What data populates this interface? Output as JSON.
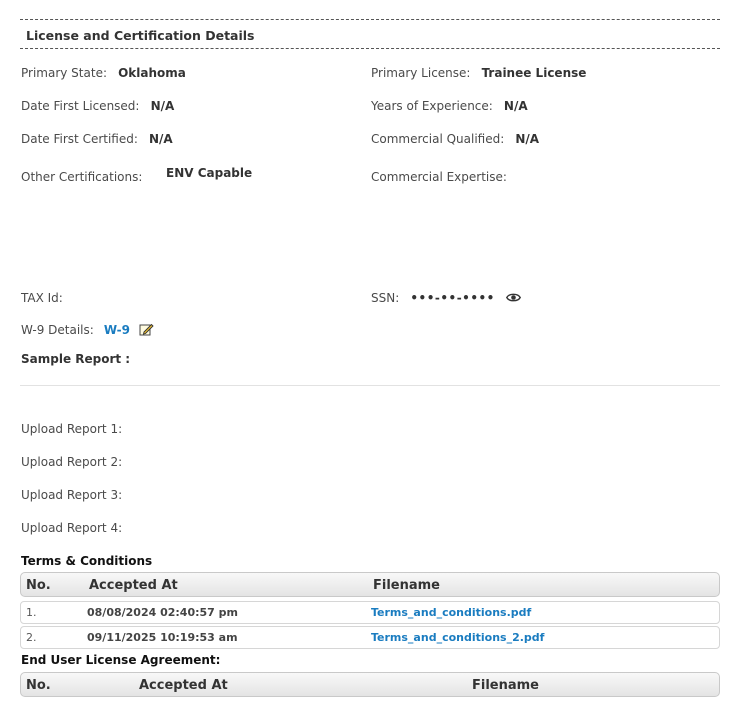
{
  "section": {
    "title": "License and Certification Details"
  },
  "details": {
    "primary_state": {
      "label": "Primary State:",
      "value": "Oklahoma"
    },
    "primary_license": {
      "label": "Primary License:",
      "value": "Trainee License"
    },
    "date_first_licensed": {
      "label": "Date First Licensed:",
      "value": "N/A"
    },
    "years_experience": {
      "label": "Years of Experience:",
      "value": "N/A"
    },
    "date_first_certified": {
      "label": "Date First Certified:",
      "value": "N/A"
    },
    "commercial_qualified": {
      "label": "Commercial Qualified:",
      "value": "N/A"
    },
    "other_certifications": {
      "label": "Other Certifications:",
      "value": "ENV Capable"
    },
    "commercial_expertise": {
      "label": "Commercial Expertise:",
      "value": ""
    },
    "tax_id": {
      "label": "TAX Id:",
      "value": ""
    },
    "ssn": {
      "label": "SSN:",
      "value": "•••-••-••••",
      "icon": "eye-icon"
    },
    "w9": {
      "label": "W-9 Details:",
      "value": "W-9",
      "icon": "edit-icon"
    },
    "sample_report": {
      "label": "Sample Report :"
    }
  },
  "uploads": [
    {
      "label": "Upload Report 1:"
    },
    {
      "label": "Upload Report 2:"
    },
    {
      "label": "Upload Report 3:"
    },
    {
      "label": "Upload Report 4:"
    }
  ],
  "terms": {
    "title": "Terms & Conditions",
    "columns": [
      "No.",
      "Accepted At",
      "Filename"
    ],
    "rows": [
      {
        "no": "1.",
        "accepted_at": "08/08/2024 02:40:57 pm",
        "filename": "Terms_and_conditions.pdf"
      },
      {
        "no": "2.",
        "accepted_at": "09/11/2025 10:19:53 am",
        "filename": "Terms_and_conditions_2.pdf"
      }
    ]
  },
  "eula": {
    "title": "End User License Agreement:",
    "columns": [
      "No.",
      "Accepted At",
      "Filename"
    ]
  },
  "colors": {
    "link": "#1a7cc0",
    "text": "#444444"
  }
}
